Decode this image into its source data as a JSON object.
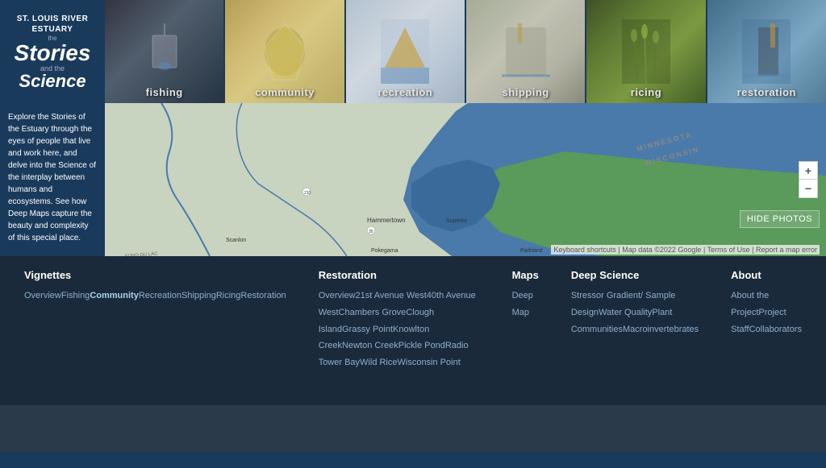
{
  "logo": {
    "line1": "ST. LOUIS RIVER",
    "line2": "ESTUARY",
    "the": "the",
    "stories": "Stories",
    "and_the": "and the",
    "science": "Science"
  },
  "photo_strip": [
    {
      "id": "fishing",
      "label": "fishing",
      "css_class": "card-fishing"
    },
    {
      "id": "community",
      "label": "community",
      "css_class": "card-community"
    },
    {
      "id": "recreation",
      "label": "recreation",
      "css_class": "card-recreation"
    },
    {
      "id": "shipping",
      "label": "shipping",
      "css_class": "card-shipping"
    },
    {
      "id": "ricing",
      "label": "ricing",
      "css_class": "card-ricing"
    },
    {
      "id": "restoration",
      "label": "restoration",
      "css_class": "card-restoration"
    }
  ],
  "hide_photos_btn": "HIDE PHOTOS",
  "sidebar_text": "Explore the Stories of the Estuary through the eyes of people that live and work here, and delve into the Science of the interplay between humans and ecosystems. See how Deep Maps capture the beauty and complexity of this special place.",
  "map_attribution": "Keyboard shortcuts | Map data ©2022 Google | Terms of Use | Report a map error",
  "zoom_in": "+",
  "zoom_out": "−",
  "nav": {
    "vignettes": {
      "title": "Vignettes",
      "items": [
        {
          "label": "Overview",
          "active": false
        },
        {
          "label": "Fishing",
          "active": false
        },
        {
          "label": "Community",
          "active": true
        },
        {
          "label": "Recreation",
          "active": false
        },
        {
          "label": "Shipping",
          "active": false
        },
        {
          "label": "Ricing",
          "active": false
        },
        {
          "label": "Restoration",
          "active": false
        }
      ]
    },
    "restoration": {
      "title": "Restoration",
      "items": [
        {
          "label": "Overview"
        },
        {
          "label": "21st Avenue West"
        },
        {
          "label": "40th Avenue West"
        },
        {
          "label": "Chambers Grove"
        },
        {
          "label": "Clough Island"
        },
        {
          "label": "Grassy Point"
        },
        {
          "label": "Knowlton Creek"
        },
        {
          "label": "Newton Creek"
        },
        {
          "label": "Pickle Pond"
        },
        {
          "label": "Radio Tower Bay"
        },
        {
          "label": "Wild Rice"
        },
        {
          "label": "Wisconsin Point"
        }
      ]
    },
    "maps": {
      "title": "Maps",
      "items": [
        {
          "label": "Deep Map"
        }
      ]
    },
    "deep_science": {
      "title": "Deep Science",
      "items": [
        {
          "label": "Stressor Gradient/ Sample Design"
        },
        {
          "label": "Water Quality"
        },
        {
          "label": "Plant Communities"
        },
        {
          "label": "Macroinvertebrates"
        }
      ]
    },
    "about": {
      "title": "About",
      "items": [
        {
          "label": "About the Project"
        },
        {
          "label": "Project Staff"
        },
        {
          "label": "Collaborators"
        }
      ]
    }
  }
}
